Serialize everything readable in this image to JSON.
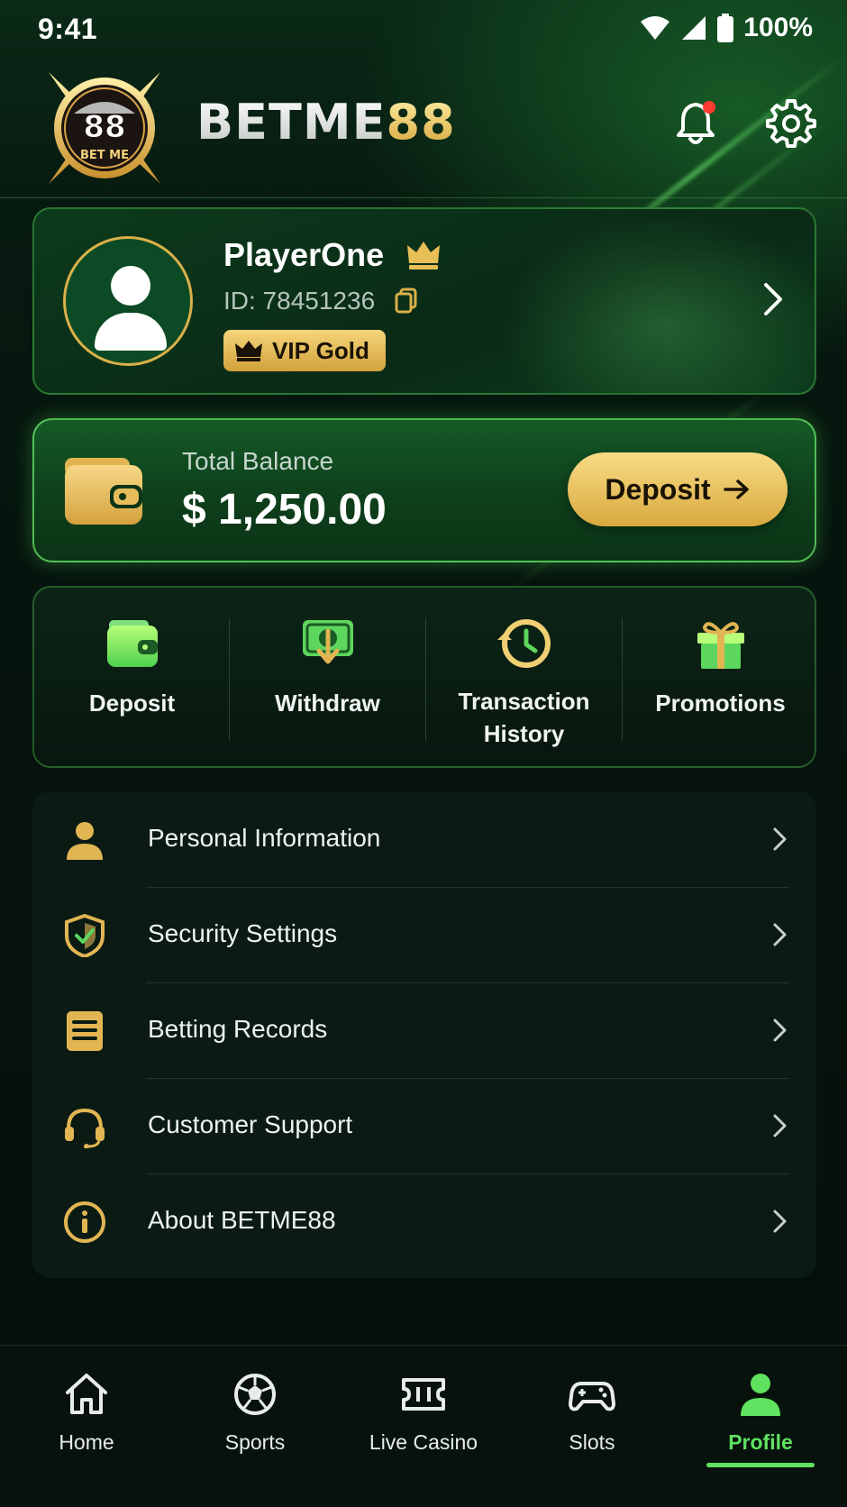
{
  "status_bar": {
    "time": "9:41",
    "battery": "100%"
  },
  "header": {
    "brand_primary": "BETME",
    "brand_accent": "88",
    "logo_text_top": "88",
    "logo_text_bottom": "BET ME"
  },
  "profile": {
    "name": "PlayerOne",
    "id_text": "ID: 78451236",
    "vip_label": "VIP Gold"
  },
  "balance": {
    "label": "Total Balance",
    "amount": "$ 1,250.00",
    "deposit_label": "Deposit"
  },
  "quick_actions": [
    {
      "label": "Deposit",
      "icon": "wallet-icon"
    },
    {
      "label": "Withdraw",
      "icon": "cash-withdraw-icon"
    },
    {
      "label_line1": "Transaction",
      "label_line2": "History",
      "icon": "history-icon"
    },
    {
      "label": "Promotions",
      "icon": "gift-icon"
    }
  ],
  "menu": [
    {
      "label": "Personal Information",
      "icon": "person-icon"
    },
    {
      "label": "Security Settings",
      "icon": "shield-check-icon"
    },
    {
      "label": "Betting Records",
      "icon": "document-icon"
    },
    {
      "label": "Customer Support",
      "icon": "headset-icon"
    },
    {
      "label": "About BETME88",
      "icon": "info-icon"
    }
  ],
  "bottom_nav": [
    {
      "label": "Home",
      "icon": "home-icon"
    },
    {
      "label": "Sports",
      "icon": "soccer-ball-icon"
    },
    {
      "label": "Live Casino",
      "icon": "ticket-icon"
    },
    {
      "label": "Slots",
      "icon": "gamepad-icon"
    },
    {
      "label": "Profile",
      "icon": "profile-icon",
      "active": true
    }
  ],
  "colors": {
    "gold": "#d9b04a",
    "active_green": "#5fe25f",
    "notification_red": "#ff3b30",
    "background": "#06110d"
  }
}
